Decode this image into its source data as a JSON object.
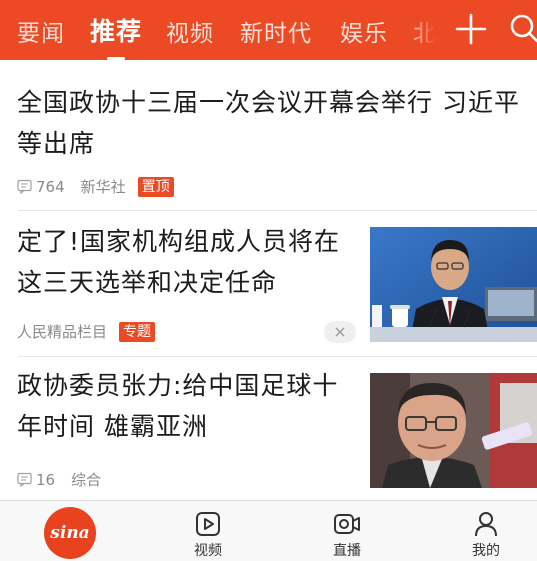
{
  "colors": {
    "brand": "#ec4a24",
    "tab_text": "#ffffff",
    "meta_text": "#8a8a8a"
  },
  "top_tabs": [
    {
      "label": "要闻",
      "active": false
    },
    {
      "label": "推荐",
      "active": true
    },
    {
      "label": "视频",
      "active": false
    },
    {
      "label": "新时代",
      "active": false
    },
    {
      "label": "娱乐",
      "active": false
    },
    {
      "label": "北",
      "active": false
    }
  ],
  "topbar_icons": {
    "add": "plus-icon",
    "search": "search-icon"
  },
  "feed": [
    {
      "headline": "全国政协十三届一次会议开幕会举行 习近平等出席",
      "comment_count": "764",
      "source": "新华社",
      "badge": "置顶",
      "thumbnail": null
    },
    {
      "headline": "定了!国家机构组成人员将在这三天选举和决定任命",
      "source": "人民精品栏目",
      "badge": "专题",
      "thumbnail": "press-conference-photo",
      "dismiss_icon": "close-icon"
    },
    {
      "headline": "政协委员张力:给中国足球十年时间 雄霸亚洲",
      "comment_count": "16",
      "source": "综合",
      "thumbnail": "interview-photo"
    }
  ],
  "bottom_nav": {
    "logo_text": "sina",
    "items": [
      {
        "label": "视频",
        "icon": "video-icon"
      },
      {
        "label": "直播",
        "icon": "live-camera-icon"
      },
      {
        "label": "我的",
        "icon": "user-icon"
      }
    ]
  }
}
